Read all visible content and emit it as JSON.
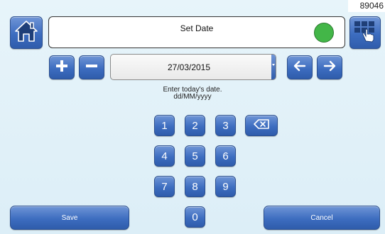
{
  "corner_id": "89046",
  "header": {
    "title": "Set Date",
    "status_color": "#43b648"
  },
  "date_field": {
    "value": "27/03/2015"
  },
  "hint": {
    "line1": "Enter today's date.",
    "line2": "dd/MM/yyyy"
  },
  "keypad": {
    "keys": [
      "1",
      "2",
      "3",
      "4",
      "5",
      "6",
      "7",
      "8",
      "9",
      "0"
    ]
  },
  "footer": {
    "save_label": "Save",
    "cancel_label": "Cancel"
  },
  "icons": {
    "home": "home-icon",
    "keypad": "keypad-hand-icon",
    "plus": "plus-icon",
    "minus": "minus-icon",
    "left": "arrow-left-icon",
    "right": "arrow-right-icon",
    "backspace": "backspace-icon"
  },
  "colors": {
    "accent": "#3d6dc0",
    "background": "#e2f1f8"
  }
}
